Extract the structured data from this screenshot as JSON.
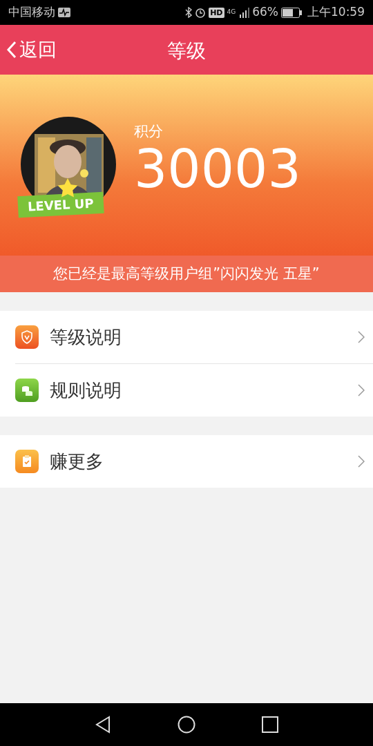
{
  "status_bar": {
    "carrier": "中国移动",
    "battery": "66%",
    "time": "上午10:59",
    "hd": "HD",
    "network": "4G"
  },
  "header": {
    "back": "返回",
    "title": "等级"
  },
  "profile": {
    "badge": "LEVEL UP",
    "points_label": "积分",
    "points": "30003",
    "notice": "您已经是最高等级用户组”闪闪发光 五星”"
  },
  "menu_groups": [
    {
      "items": [
        {
          "label": "等级说明",
          "kind": "shield"
        },
        {
          "label": "规则说明",
          "kind": "coins"
        }
      ]
    },
    {
      "items": [
        {
          "label": "赚更多",
          "kind": "clipboard"
        }
      ]
    }
  ]
}
